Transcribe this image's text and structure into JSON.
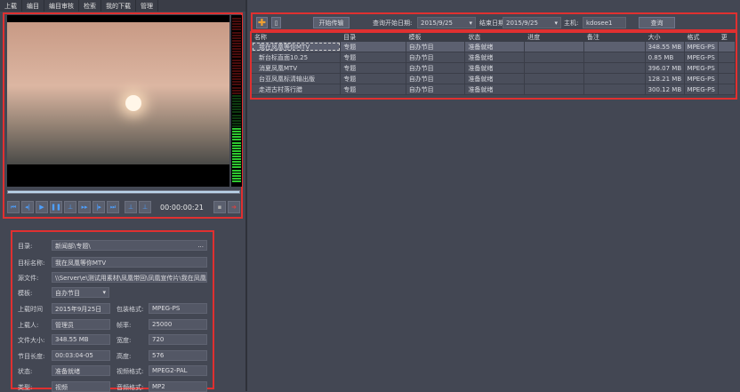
{
  "menu": [
    "上载",
    "编目",
    "编目审核",
    "检索",
    "我的下载",
    "管理"
  ],
  "player": {
    "timecode": "00:00:00:21"
  },
  "toolbar": {
    "start_label": "开始传输",
    "query_start_label": "查询开始日期:",
    "query_start": "2015/9/25",
    "end_label": "结束日期:",
    "end": "2015/9/25",
    "host_label": "主机:",
    "host": "kdosee1",
    "query_label": "查询"
  },
  "table": {
    "columns": [
      "名称",
      "目录",
      "模板",
      "状态",
      "进度",
      "备注",
      "大小",
      "格式",
      "更"
    ],
    "rows": [
      [
        "我在凤凰等你MTV",
        "专题",
        "自办节目",
        "准备就绪",
        "",
        "",
        "348.55 MB",
        "MPEG-PS"
      ],
      [
        "新台标直面10.25",
        "专题",
        "自办节目",
        "准备就绪",
        "",
        "",
        "0.85 MB",
        "MPEG-PS"
      ],
      [
        "消夏凤凰MTV",
        "专题",
        "自办节目",
        "准备就绪",
        "",
        "",
        "396.07 MB",
        "MPEG-PS"
      ],
      [
        "台亚凤凰标清输出版",
        "专题",
        "自办节目",
        "准备就绪",
        "",
        "",
        "128.21 MB",
        "MPEG-PS"
      ],
      [
        "走进古村落行腊",
        "专题",
        "自办节目",
        "准备就绪",
        "",
        "",
        "300.12 MB",
        "MPEG-PS"
      ]
    ]
  },
  "info": {
    "dir_label": "目录:",
    "dir": "新闻部\\专题\\",
    "dir_btn": "...",
    "name_label": "目标名称:",
    "name": "我在凤凰等你MTV",
    "src_label": "源文件:",
    "src": "\\\\Server\\e\\测试用素材\\凤凰带回\\凤凰宣传片\\我在凤凰等",
    "tpl_label": "模板:",
    "tpl": "自办节目",
    "left": [
      [
        "上载时间",
        "2015年9月25日"
      ],
      [
        "上载人:",
        "管理员"
      ],
      [
        "文件大小:",
        "348.55 MB"
      ],
      [
        "节目长度:",
        "00:03:04-05"
      ],
      [
        "状态:",
        "准备就绪"
      ],
      [
        "类型:",
        "视频"
      ]
    ],
    "right": [
      [
        "包装格式:",
        "MPEG-PS"
      ],
      [
        "帧率:",
        "25000"
      ],
      [
        "宽度:",
        "720"
      ],
      [
        "高度:",
        "576"
      ],
      [
        "视频格式:",
        "MPEG2-PAL"
      ],
      [
        "音频格式:",
        "MP2"
      ]
    ]
  }
}
